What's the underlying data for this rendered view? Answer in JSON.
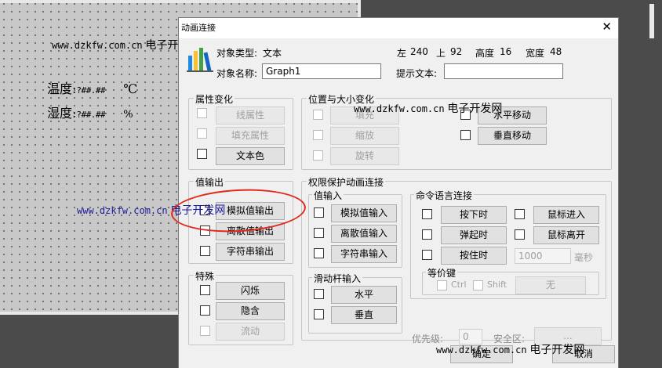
{
  "canvas": {
    "temp_label": "温度:",
    "temp_value": "?##.##",
    "temp_unit": "℃",
    "humid_label": "湿度:",
    "humid_value": "?##.##",
    "humid_unit": "%"
  },
  "watermark": {
    "url": "www.dzkfw.com.cn",
    "name": "电子开发网"
  },
  "dialog": {
    "title": "动画连接",
    "object_type_label": "对象类型:",
    "object_type_value": "文本",
    "left_label": "左",
    "left_value": "240",
    "top_label": "上",
    "top_value": "92",
    "height_label": "高度",
    "height_value": "16",
    "width_label": "宽度",
    "width_value": "48",
    "object_name_label": "对象名称:",
    "object_name_value": "Graph1",
    "hint_label": "提示文本:",
    "hint_value": "",
    "attr_group": {
      "title": "属性变化",
      "items": [
        "线属性",
        "填充属性",
        "文本色"
      ]
    },
    "pos_group": {
      "title": "位置与大小变化",
      "left_items": [
        "填充",
        "缩放",
        "旋转"
      ],
      "right_items": [
        "水平移动",
        "垂直移动"
      ]
    },
    "output_group": {
      "title": "值输出",
      "items": [
        "模拟值输出",
        "离散值输出",
        "字符串输出"
      ]
    },
    "perm_group": {
      "title": "权限保护动画连接"
    },
    "input_group": {
      "title": "值输入",
      "items": [
        "模拟值输入",
        "离散值输入",
        "字符串输入"
      ]
    },
    "cmd_group": {
      "title": "命令语言连接",
      "left_items": [
        "按下时",
        "弹起时",
        "按住时"
      ],
      "right_items": [
        "鼠标进入",
        "鼠标离开"
      ],
      "interval_value": "1000",
      "interval_unit": "毫秒"
    },
    "equiv_group": {
      "title": "等价键",
      "ctrl": "Ctrl",
      "shift": "Shift",
      "key": "无"
    },
    "special_group": {
      "title": "特殊",
      "items": [
        "闪烁",
        "隐含",
        "流动"
      ]
    },
    "slider_group": {
      "title": "滑动杆输入",
      "items": [
        "水平",
        "垂直"
      ]
    },
    "priority_label": "优先级:",
    "priority_value": "0",
    "security_label": "安全区:",
    "security_button": "...",
    "ok": "确定",
    "cancel": "取消"
  }
}
